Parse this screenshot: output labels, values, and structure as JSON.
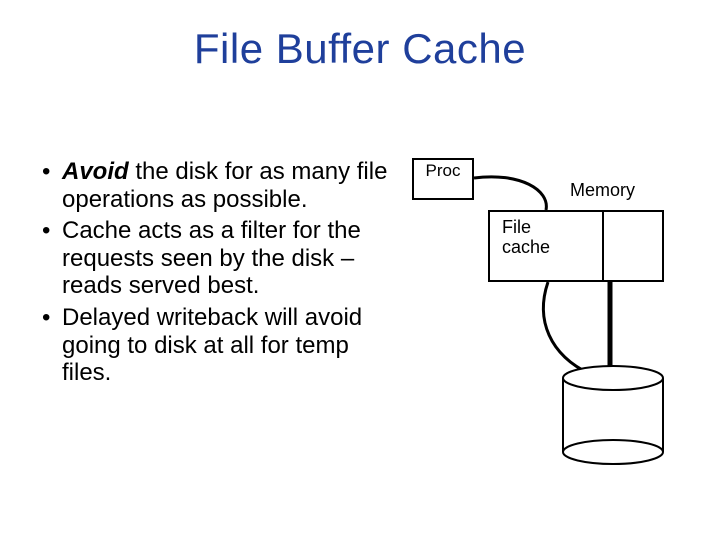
{
  "title": "File Buffer Cache",
  "bullets": {
    "b1_avoid": "Avoid",
    "b1_rest": " the disk for as many file operations as possible.",
    "b2": "Cache acts as a filter for the requests seen by the disk – reads served best.",
    "b3": "Delayed writeback will avoid going to disk at all for temp files."
  },
  "diagram": {
    "proc": "Proc",
    "memory": "Memory",
    "file_cache": "File cache"
  }
}
